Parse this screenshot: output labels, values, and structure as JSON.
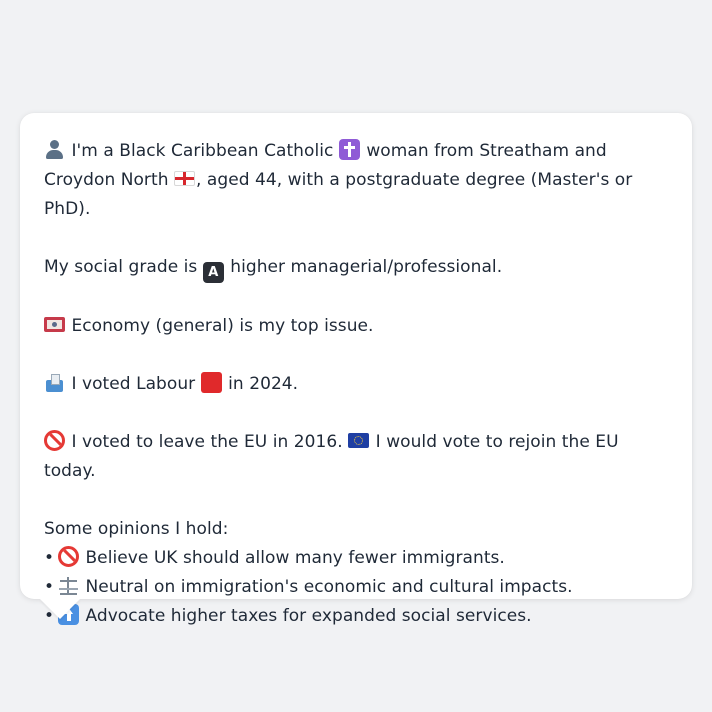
{
  "profile": {
    "line1_a": "I'm a Black Caribbean Catholic",
    "line1_b": "woman from Streatham and Croydon North",
    "line1_c": ", aged 44, with a postgraduate degree (Master's or PhD).",
    "social_grade_a": "My social grade is",
    "social_grade_b": "higher managerial/professional.",
    "top_issue": "Economy (general) is my top issue.",
    "voted_a": "I voted Labour",
    "voted_b": "in 2024.",
    "eu_a": "I voted to leave the EU in 2016.",
    "eu_b": "I would vote to rejoin the EU today.",
    "opinions_heading": "Some opinions I hold:",
    "opinions": [
      "Believe UK should allow many fewer immigrants.",
      "Neutral on immigration's economic and cultural impacts.",
      "Advocate higher taxes for expanded social services."
    ],
    "bullet_char": "•",
    "a_button_letter": "A"
  },
  "icons": {
    "line1": "bust-in-silhouette-icon",
    "religion": "latin-cross-icon",
    "region": "england-flag-icon",
    "grade": "a-button-icon",
    "issue": "money-icon",
    "vote": "ballot-box-icon",
    "party": "red-square-icon",
    "eu_leave": "prohibited-icon",
    "eu_flag": "eu-flag-icon",
    "opinion1": "prohibited-icon",
    "opinion2": "balance-scale-icon",
    "opinion3": "up-arrow-icon"
  },
  "colors": {
    "background": "#f1f2f4",
    "card": "#ffffff",
    "text": "#1f2937",
    "labour_red": "#e0292b"
  }
}
